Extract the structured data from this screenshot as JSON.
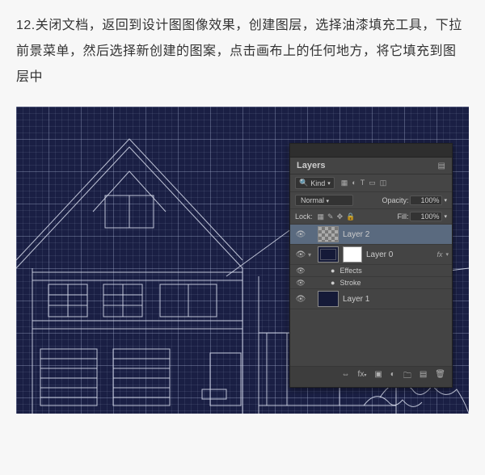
{
  "instruction_text": "12.关闭文档，返回到设计图图像效果，创建图层，选择油漆填充工具，下拉前景菜单，然后选择新创建的图案，点击画布上的任何地方，将它填充到图层中",
  "panel": {
    "title": "Layers",
    "filter_kind": "Kind",
    "blend_mode": "Normal",
    "opacity_label": "Opacity:",
    "opacity_value": "100%",
    "lock_label": "Lock:",
    "fill_label": "Fill:",
    "fill_value": "100%"
  },
  "layers": {
    "layer2": "Layer 2",
    "layer0": "Layer 0",
    "fx_badge": "fx",
    "effects": "Effects",
    "stroke": "Stroke",
    "layer1": "Layer 1"
  }
}
